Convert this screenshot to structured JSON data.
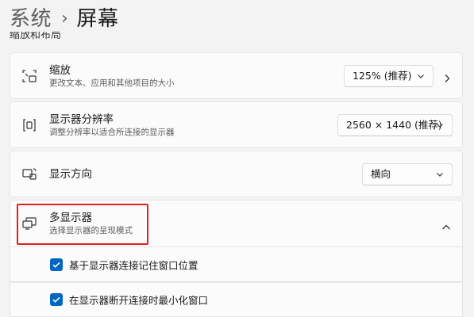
{
  "breadcrumb": {
    "parent": "系统",
    "separator": "›",
    "current": "屏幕"
  },
  "section_title": "缩放和布局",
  "scale": {
    "title": "缩放",
    "description": "更改文本、应用和其他项目的大小",
    "value": "125% (推荐)"
  },
  "resolution": {
    "title": "显示器分辨率",
    "description": "调整分辨率以适合所连接的显示器",
    "value": "2560 × 1440 (推荐)"
  },
  "orientation": {
    "title": "显示方向",
    "value": "横向"
  },
  "multiple_displays": {
    "title": "多显示器",
    "description": "选择显示器的呈现模式",
    "options": [
      {
        "label": "基于显示器连接记住窗口位置",
        "checked": true
      },
      {
        "label": "在显示器断开连接时最小化窗口",
        "checked": true
      }
    ]
  },
  "colors": {
    "accent": "#0067c0",
    "highlight": "#e02020"
  }
}
